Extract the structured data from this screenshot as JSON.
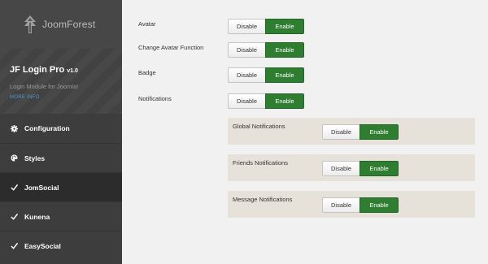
{
  "brand": {
    "name": "JoomForest",
    "logo_icon": "tree-icon"
  },
  "product": {
    "title": "JF Login Pro",
    "version": "v1.0",
    "subtitle": "Login Module for Joomla!",
    "more_info": "MORE INFO"
  },
  "nav": [
    {
      "label": "Configuration",
      "icon": "gear-icon",
      "active": false
    },
    {
      "label": "Styles",
      "icon": "palette-icon",
      "active": false
    },
    {
      "label": "JomSocial",
      "icon": "check-icon",
      "active": true
    },
    {
      "label": "Kunena",
      "icon": "check-icon",
      "active": false
    },
    {
      "label": "EasySocial",
      "icon": "check-icon",
      "active": false
    }
  ],
  "settings": [
    {
      "label": "Avatar",
      "disable": "Disable",
      "enable": "Enable",
      "value": "Enable"
    },
    {
      "label": "Change Avatar Function",
      "disable": "Disable",
      "enable": "Enable",
      "value": "Enable"
    },
    {
      "label": "Badge",
      "disable": "Disable",
      "enable": "Enable",
      "value": "Enable"
    },
    {
      "label": "Notifications",
      "disable": "Disable",
      "enable": "Enable",
      "value": "Enable"
    }
  ],
  "subsettings": [
    {
      "label": "Global Notifications",
      "disable": "Disable",
      "enable": "Enable",
      "value": "Enable"
    },
    {
      "label": "Friends Notifications",
      "disable": "Disable",
      "enable": "Enable",
      "value": "Enable"
    },
    {
      "label": "Message Notifications",
      "disable": "Disable",
      "enable": "Enable",
      "value": "Enable"
    }
  ],
  "colors": {
    "enable_active": "#2f7d31",
    "sidebar_bg": "#3d3d3d",
    "accent_link": "#4d9ad6"
  }
}
